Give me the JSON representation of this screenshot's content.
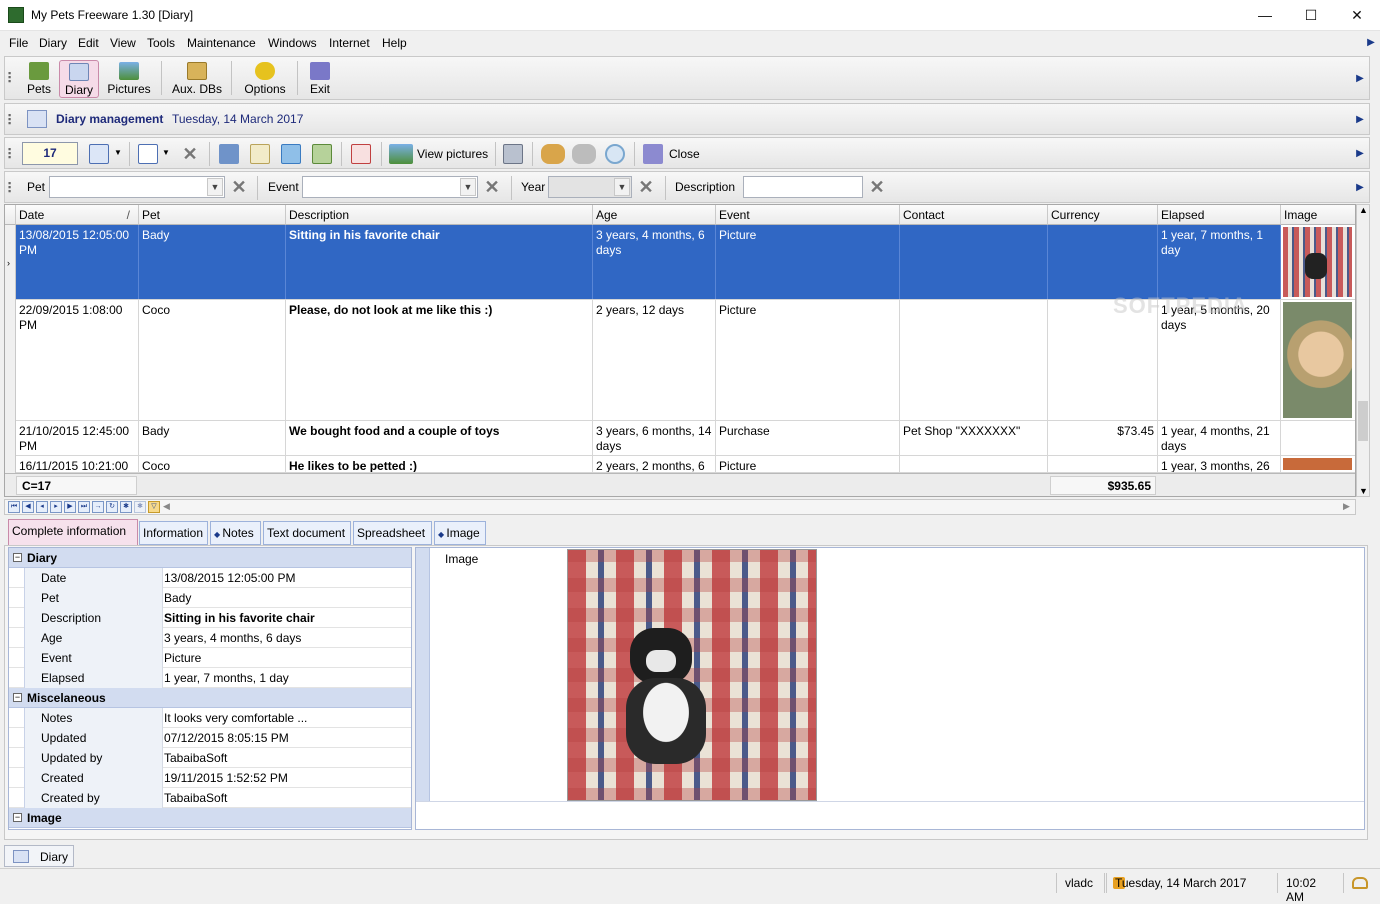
{
  "window": {
    "title": "My Pets Freeware 1.30 [Diary]",
    "min_glyph": "—",
    "max_glyph": "☐",
    "close_glyph": "✕"
  },
  "menu": [
    "File",
    "Diary",
    "Edit",
    "View",
    "Tools",
    "Maintenance",
    "Windows",
    "Internet",
    "Help"
  ],
  "main_toolbar": {
    "pets": "Pets",
    "diary": "Diary",
    "pictures": "Pictures",
    "auxdbs": "Aux. DBs",
    "options": "Options",
    "exit": "Exit"
  },
  "header": {
    "title": "Diary management",
    "date": "Tuesday, 14 March 2017"
  },
  "action_toolbar": {
    "count": "17",
    "view_pictures": "View pictures",
    "close": "Close"
  },
  "filters": {
    "pet_label": "Pet",
    "event_label": "Event",
    "year_label": "Year",
    "description_label": "Description"
  },
  "grid": {
    "columns": [
      "Date",
      "Pet",
      "Description",
      "Age",
      "Event",
      "Contact",
      "Currency",
      "Elapsed",
      "Image"
    ],
    "sort_glyph": "/",
    "rows": [
      {
        "date": "13/08/2015 12:05:00 PM",
        "pet": "Bady",
        "description": "Sitting in his favorite chair",
        "age": "3 years, 4 months, 6 days",
        "event": "Picture",
        "contact": "",
        "currency": "",
        "elapsed": "1 year, 7 months, 1 day"
      },
      {
        "date": "22/09/2015 1:08:00 PM",
        "pet": "Coco",
        "description": "Please, do not look at me like this :)",
        "age": "2 years, 12 days",
        "event": "Picture",
        "contact": "",
        "currency": "",
        "elapsed": "1 year, 5 months, 20 days"
      },
      {
        "date": "21/10/2015 12:45:00 PM",
        "pet": "Bady",
        "description": "We bought food and a couple of toys",
        "age": "3 years, 6 months, 14 days",
        "event": "Purchase",
        "contact": "Pet Shop \"XXXXXXX\"",
        "currency": "$73.45",
        "elapsed": "1 year, 4 months, 21 days"
      },
      {
        "date": "16/11/2015 10:21:00",
        "pet": "Coco",
        "description": "He likes to be petted :)",
        "age": "2 years, 2 months, 6",
        "event": "Picture",
        "contact": "",
        "currency": "",
        "elapsed": "1 year, 3 months, 26"
      }
    ],
    "footer_count": "C=17",
    "footer_total": "$935.65",
    "watermark": "SOFTPEDIA"
  },
  "tabs": [
    "Complete information",
    "Information",
    "Notes",
    "Text document",
    "Spreadsheet",
    "Image"
  ],
  "details": {
    "cat_diary": "Diary",
    "cat_misc": "Miscelaneous",
    "cat_image": "Image",
    "rows_diary": [
      {
        "k": "Date",
        "v": "13/08/2015 12:05:00 PM"
      },
      {
        "k": "Pet",
        "v": "Bady"
      },
      {
        "k": "Description",
        "v": "Sitting in his favorite chair"
      },
      {
        "k": "Age",
        "v": "3 years, 4 months, 6 days"
      },
      {
        "k": "Event",
        "v": "Picture"
      },
      {
        "k": "Elapsed",
        "v": "1 year, 7 months, 1 day"
      }
    ],
    "rows_misc": [
      {
        "k": "Notes",
        "v": "It looks very comfortable ..."
      },
      {
        "k": "Updated",
        "v": "07/12/2015 8:05:15 PM"
      },
      {
        "k": "Updated by",
        "v": "TabaibaSoft"
      },
      {
        "k": "Created",
        "v": "19/11/2015 1:52:52 PM"
      },
      {
        "k": "Created by",
        "v": "TabaibaSoft"
      }
    ],
    "image_label": "Image"
  },
  "bottom_tab": "Diary",
  "status": {
    "user": "vladc",
    "date": "Tuesday, 14 March 2017",
    "time": "10:02 AM"
  },
  "colors": {
    "selection": "#3067c4",
    "category_bg": "#d2dcf0",
    "active_tab": "#f6e1ec"
  }
}
